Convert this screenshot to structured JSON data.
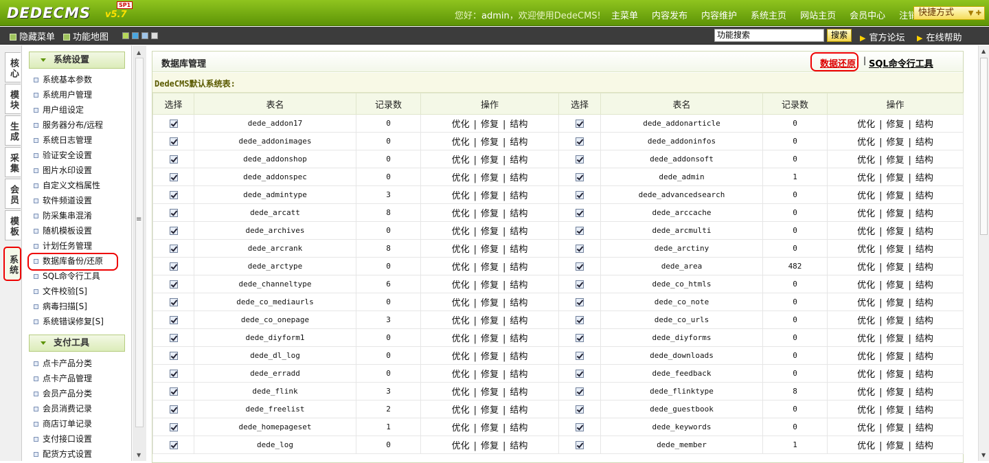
{
  "header": {
    "logo": "DEDECMS",
    "version": "v5.7",
    "badge": "SP1",
    "greeting_prefix": "您好：",
    "username": "admin",
    "greeting_suffix": "，欢迎使用DedeCMS!",
    "nav": [
      "主菜单",
      "内容发布",
      "内容维护",
      "系统主页",
      "网站主页",
      "会员中心",
      "注销"
    ],
    "quick_menu": "快捷方式"
  },
  "toolbar": {
    "hide_menu": "隐藏菜单",
    "func_map": "功能地图",
    "swatch_colors": [
      "#b6d75a",
      "#4aa6e0",
      "#9fc4e8",
      "#dddddd"
    ],
    "search_value": "功能搜索",
    "search_button": "搜索",
    "forum_link": "官方论坛",
    "help_link": "在线帮助"
  },
  "vtabs": [
    {
      "label": "核心",
      "active": false
    },
    {
      "label": "模块",
      "active": false
    },
    {
      "label": "生成",
      "active": false
    },
    {
      "label": "采集",
      "active": false
    },
    {
      "label": "会员",
      "active": false
    },
    {
      "label": "模板",
      "active": false
    },
    {
      "label": "系统",
      "active": true
    }
  ],
  "sidebar": {
    "group1": {
      "title": "系统设置",
      "items": [
        "系统基本参数",
        "系统用户管理",
        "用户组设定",
        "服务器分布/远程",
        "系统日志管理",
        "验证安全设置",
        "图片水印设置",
        "自定义文档属性",
        "软件频道设置",
        "防采集串混淆",
        "随机模板设置",
        "计划任务管理",
        "数据库备份/还原",
        "SQL命令行工具",
        "文件校验[S]",
        "病毒扫描[S]",
        "系统错误修复[S]"
      ]
    },
    "group2": {
      "title": "支付工具",
      "items": [
        "点卡产品分类",
        "点卡产品管理",
        "会员产品分类",
        "会员消费记录",
        "商店订单记录",
        "支付接口设置",
        "配货方式设置"
      ]
    }
  },
  "panel": {
    "title": "数据库管理",
    "restore_link": "数据还原",
    "separator": "|",
    "sql_link": "SQL命令行工具",
    "subheading": "DedeCMS默认系统表:"
  },
  "table": {
    "headers": [
      "选择",
      "表名",
      "记录数",
      "操作",
      "选择",
      "表名",
      "记录数",
      "操作"
    ],
    "op_optimize": "优化",
    "op_repair": "修复",
    "op_structure": "结构",
    "op_sep": "|",
    "rows": [
      [
        "dede_addon17",
        "0",
        "dede_addonarticle",
        "0"
      ],
      [
        "dede_addonimages",
        "0",
        "dede_addoninfos",
        "0"
      ],
      [
        "dede_addonshop",
        "0",
        "dede_addonsoft",
        "0"
      ],
      [
        "dede_addonspec",
        "0",
        "dede_admin",
        "1"
      ],
      [
        "dede_admintype",
        "3",
        "dede_advancedsearch",
        "0"
      ],
      [
        "dede_arcatt",
        "8",
        "dede_arccache",
        "0"
      ],
      [
        "dede_archives",
        "0",
        "dede_arcmulti",
        "0"
      ],
      [
        "dede_arcrank",
        "8",
        "dede_arctiny",
        "0"
      ],
      [
        "dede_arctype",
        "0",
        "dede_area",
        "482"
      ],
      [
        "dede_channeltype",
        "6",
        "dede_co_htmls",
        "0"
      ],
      [
        "dede_co_mediaurls",
        "0",
        "dede_co_note",
        "0"
      ],
      [
        "dede_co_onepage",
        "3",
        "dede_co_urls",
        "0"
      ],
      [
        "dede_diyform1",
        "0",
        "dede_diyforms",
        "0"
      ],
      [
        "dede_dl_log",
        "0",
        "dede_downloads",
        "0"
      ],
      [
        "dede_erradd",
        "0",
        "dede_feedback",
        "0"
      ],
      [
        "dede_flink",
        "3",
        "dede_flinktype",
        "8"
      ],
      [
        "dede_freelist",
        "2",
        "dede_guestbook",
        "0"
      ],
      [
        "dede_homepageset",
        "1",
        "dede_keywords",
        "0"
      ],
      [
        "dede_log",
        "0",
        "dede_member",
        "1"
      ]
    ]
  }
}
